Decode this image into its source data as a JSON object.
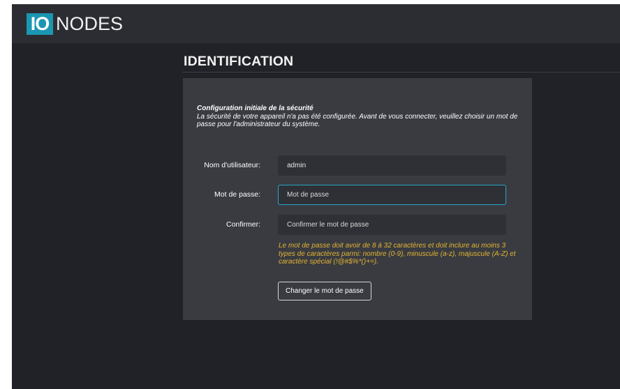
{
  "brand": {
    "logo_box": "IO",
    "logo_text": "NODES"
  },
  "page": {
    "title": "IDENTIFICATION"
  },
  "intro": {
    "heading": "Configuration initiale de la sécurité",
    "body": "La sécurité de votre appareil n'a pas été configurée. Avant de vous connecter, veuillez choisir un mot de passe pour l'administrateur du système."
  },
  "form": {
    "username": {
      "label": "Nom d'utilisateur:",
      "value": "admin"
    },
    "password": {
      "label": "Mot de passe:",
      "placeholder": "Mot de passe",
      "value": ""
    },
    "confirm": {
      "label": "Confirmer:",
      "placeholder": "Confirmer le mot de passe",
      "value": ""
    },
    "hint": "Le mot de passe doit avoir de 8 à 32 caractères et doit inclure au moins 3 types de caractères parmi: nombre (0-9), minuscule (a-z), majuscule (A-Z) et caractère spécial (!@#$%*()+=).",
    "submit_label": "Changer le mot de passe"
  },
  "colors": {
    "accent": "#1b96b3",
    "focus_border": "#27a5c7",
    "hint_text": "#e4b431",
    "background": "#212227",
    "card": "#393b41"
  }
}
